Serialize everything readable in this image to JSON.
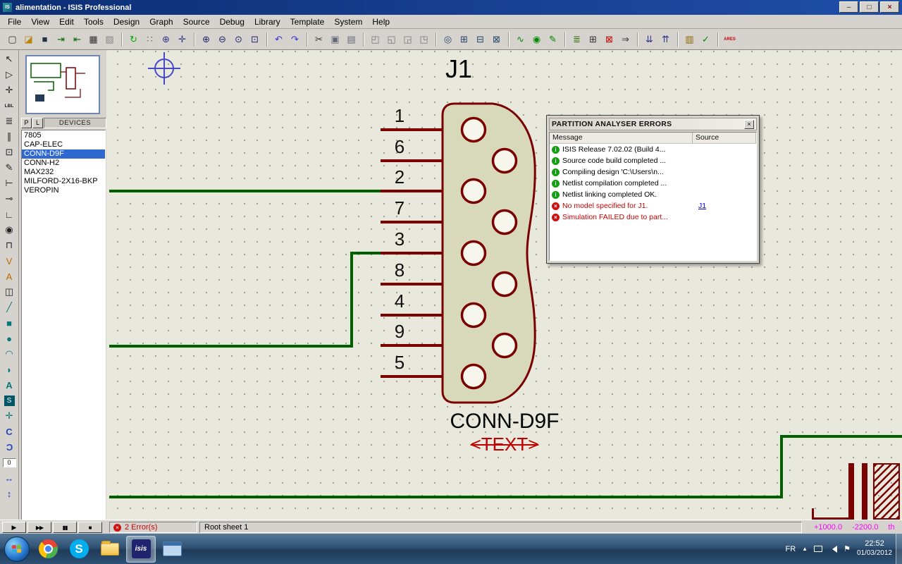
{
  "window": {
    "title": "alimentation - ISIS Professional"
  },
  "menu": {
    "items": [
      "File",
      "View",
      "Edit",
      "Tools",
      "Design",
      "Graph",
      "Source",
      "Debug",
      "Library",
      "Template",
      "System",
      "Help"
    ]
  },
  "toolbar": {
    "icons": [
      "new-file",
      "open",
      "save",
      "import-section",
      "export-section",
      "print",
      "mark-output-area",
      "redraw",
      "toggle-grid",
      "origin",
      "x-cursor",
      "zoom-in",
      "zoom-out",
      "zoom-all",
      "zoom-area",
      "undo",
      "redo",
      "cut",
      "copy",
      "paste",
      "block-copy",
      "block-move",
      "block-rotate",
      "block-delete",
      "pick-device",
      "make-device",
      "packaging-tool",
      "decompose",
      "wire-autorouter",
      "search-tag",
      "property-assignment",
      "design-explorer",
      "new-sheet",
      "remove-sheet",
      "goto-sheet",
      "zoom-child",
      "return-parent",
      "bill-of-materials",
      "electrical-rules-check",
      "netlist-to-ares"
    ]
  },
  "left_tools": {
    "icons": [
      "selection-pointer",
      "component-mode",
      "junction-mode",
      "wire-label-mode",
      "text-script-mode",
      "bus-mode",
      "subcircuit-mode",
      "instant-edit-mode",
      "terminal-mode",
      "device-pin-mode",
      "graph-mode",
      "tape-recorder-mode",
      "generator-mode",
      "voltage-probe-mode",
      "current-probe-mode",
      "virtual-instrument-mode",
      "2d-line",
      "2d-box",
      "2d-circle",
      "2d-arc",
      "2d-path",
      "2d-text",
      "2d-symbol",
      "2d-marker",
      "rotate-clockwise",
      "rotate-anticlockwise",
      "rotation-angle",
      "mirror-horizontal",
      "mirror-vertical"
    ],
    "rotation": "0"
  },
  "sidebar": {
    "p_button": "P",
    "l_button": "L",
    "header": "DEVICES",
    "devices": [
      "7805",
      "CAP-ELEC",
      "CONN-D9F",
      "CONN-H2",
      "MAX232",
      "MILFORD-2X16-BKP",
      "VEROPIN"
    ],
    "selected": "CONN-D9F"
  },
  "schematic": {
    "ref": "J1",
    "value": "CONN-D9F",
    "text_placeholder": "<TEXT>",
    "pins": [
      "1",
      "6",
      "2",
      "7",
      "3",
      "8",
      "4",
      "9",
      "5"
    ]
  },
  "error_window": {
    "title": "PARTITION ANALYSER ERRORS",
    "columns": {
      "message": "Message",
      "source": "Source"
    },
    "rows": [
      {
        "type": "info",
        "message": "ISIS Release 7.02.02 (Build 4...",
        "source": ""
      },
      {
        "type": "info",
        "message": "Source code build completed ...",
        "source": ""
      },
      {
        "type": "info",
        "message": "Compiling design 'C:\\Users\\n...",
        "source": ""
      },
      {
        "type": "info",
        "message": "Netlist compilation completed ...",
        "source": ""
      },
      {
        "type": "info",
        "message": "Netlist linking completed OK.",
        "source": ""
      },
      {
        "type": "error",
        "message": "No model specified for J1.",
        "source": "J1"
      },
      {
        "type": "error",
        "message": "Simulation FAILED due to part...",
        "source": ""
      }
    ]
  },
  "status": {
    "errors": "2 Error(s)",
    "sheet": "Root sheet 1",
    "coord_x": "+1000.0",
    "coord_y": "-2200.0",
    "unit": "th"
  },
  "taskbar": {
    "language": "FR",
    "time": "22:52",
    "date": "01/03/2012"
  },
  "colors": {
    "wire": "#006000",
    "component": "#7A0000",
    "canvas": "#E8E8DC",
    "selection": "#2E68D0"
  }
}
